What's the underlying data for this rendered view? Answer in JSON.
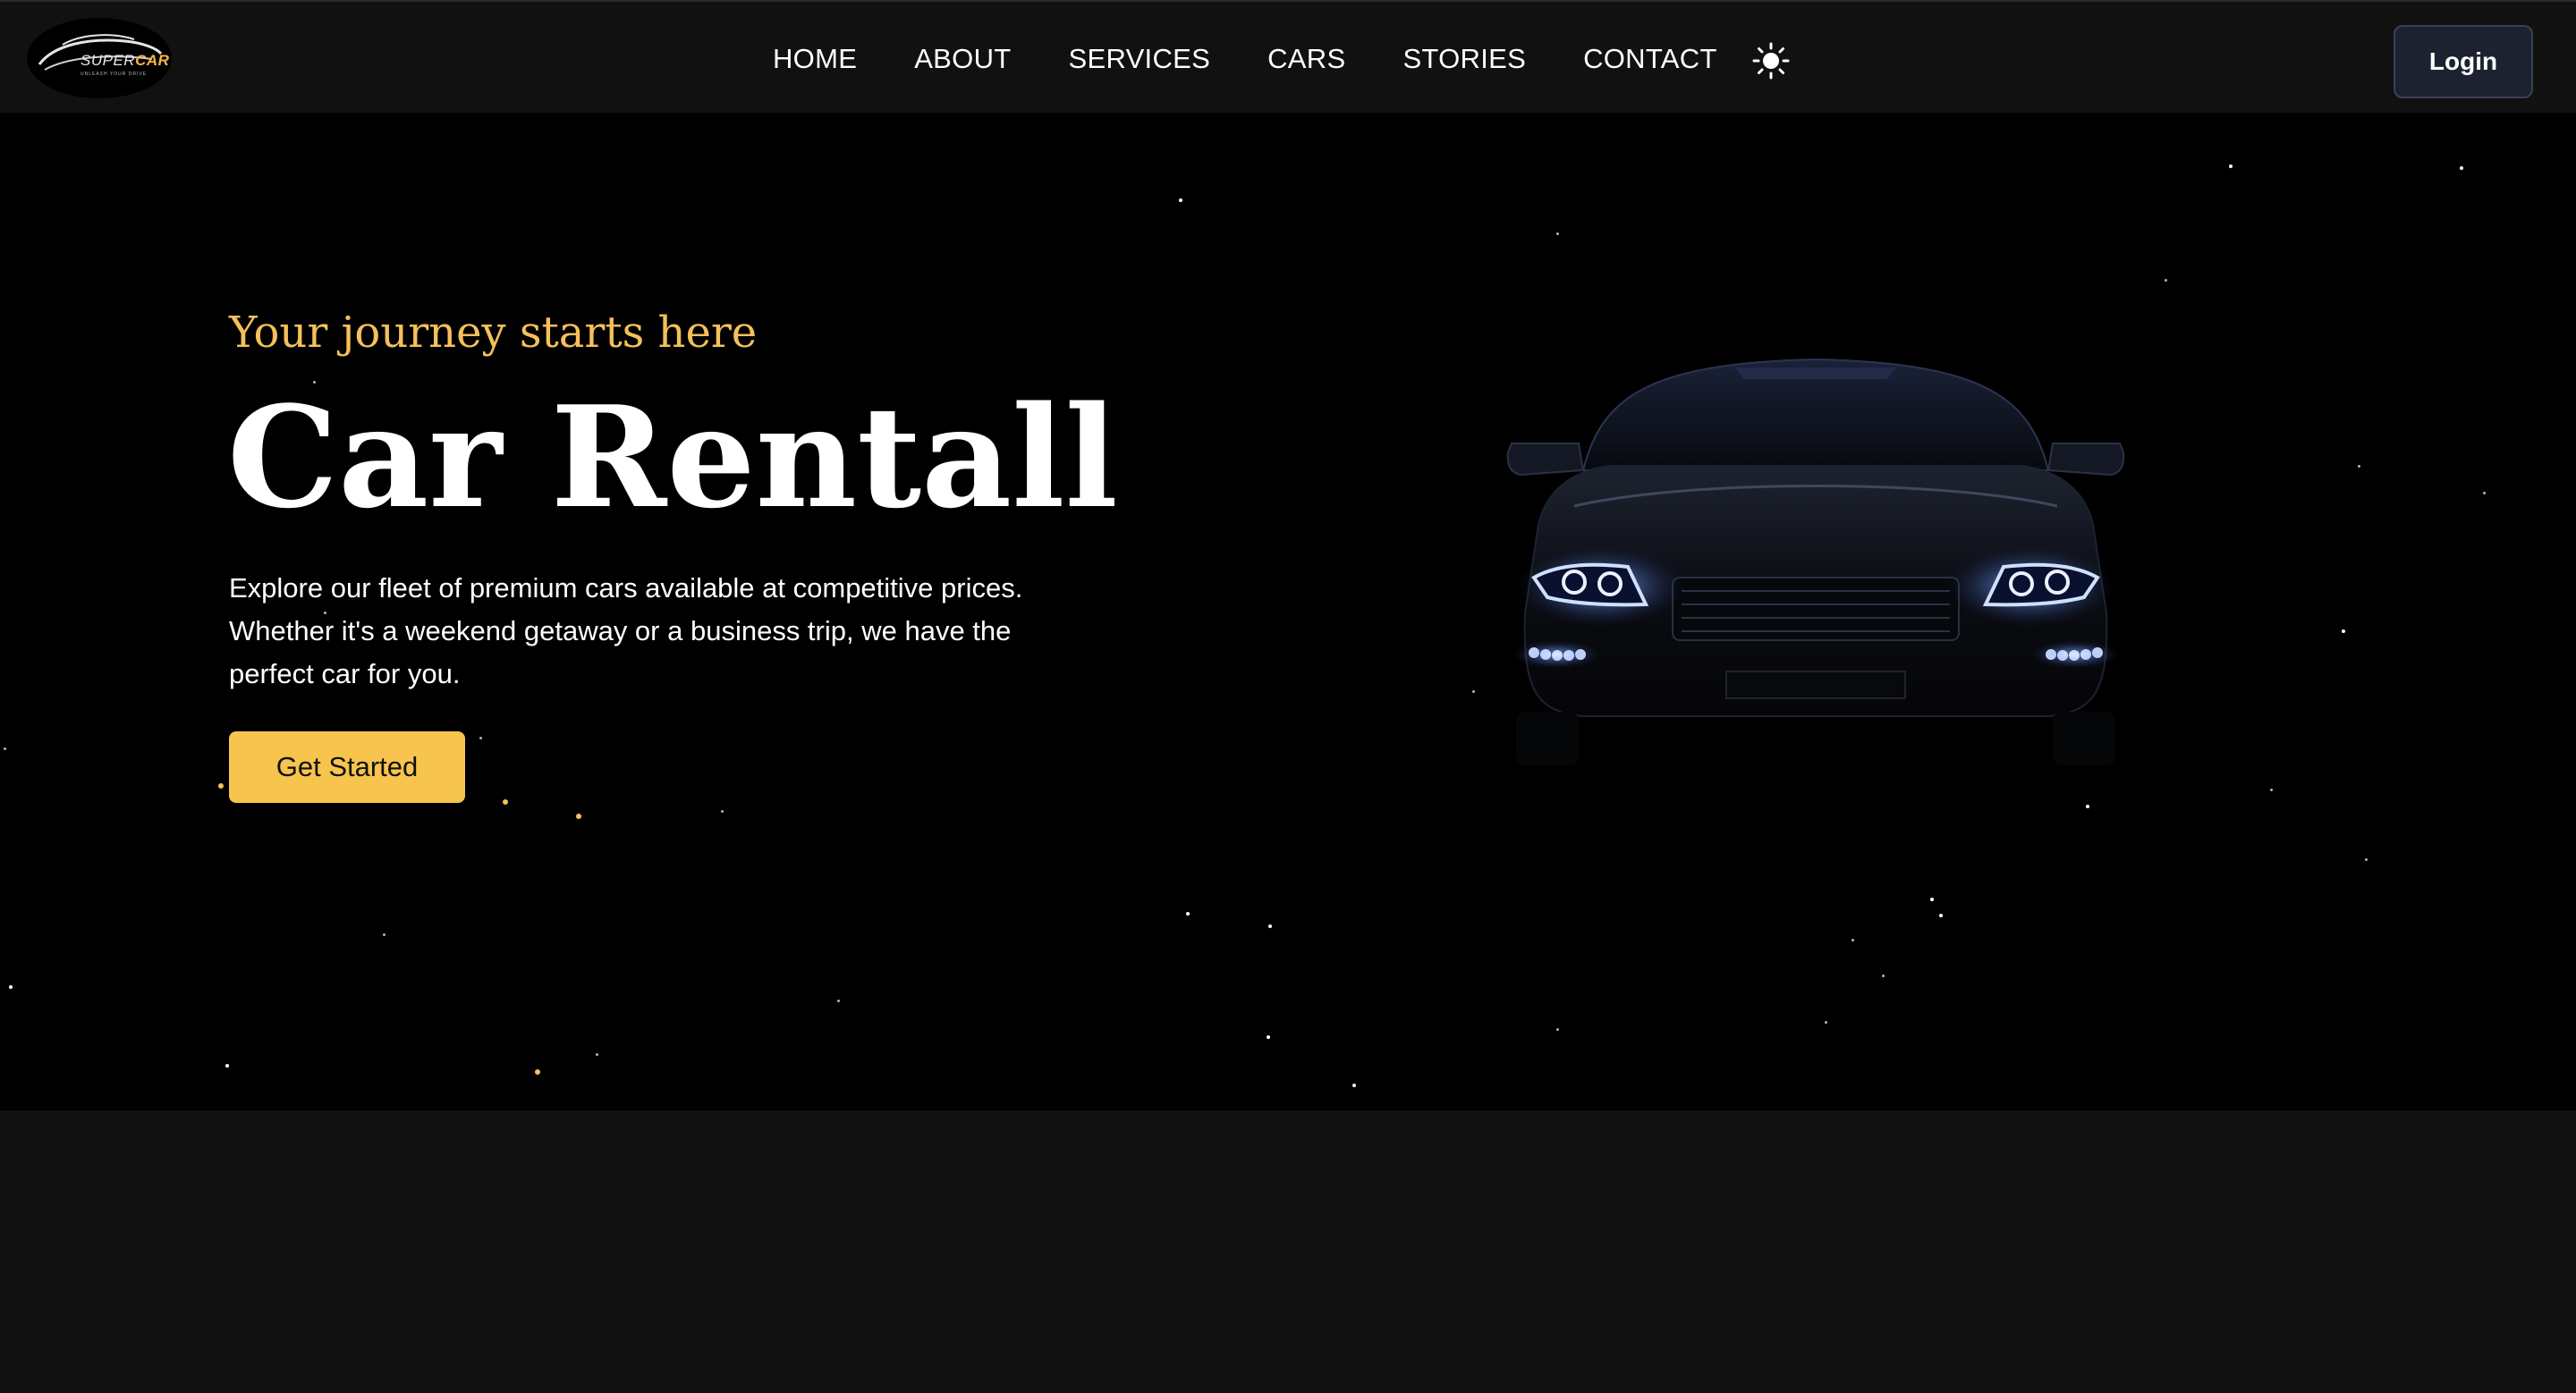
{
  "header": {
    "logo": {
      "brand_white": "SUPER",
      "brand_yellow": "CAR",
      "tagline": "UNLEASH YOUR DRIVE"
    },
    "nav": [
      {
        "label": "HOME"
      },
      {
        "label": "ABOUT"
      },
      {
        "label": "SERVICES"
      },
      {
        "label": "CARS"
      },
      {
        "label": "STORIES"
      },
      {
        "label": "CONTACT"
      }
    ],
    "theme_icon": "sun-icon",
    "login_label": "Login"
  },
  "hero": {
    "subtitle": "Your journey starts here",
    "title": "Car Rentall",
    "description": "Explore our fleet of premium cars available at competitive prices. Whether it's a weekend getaway or a business trip, we have the perfect car for you.",
    "cta_label": "Get Started",
    "image": "car-front-headlights"
  },
  "colors": {
    "accent": "#f7c44d",
    "subtitle": "#f4c05a",
    "nav_bg": "#111111",
    "hero_bg": "#000000",
    "page_bg": "#121212",
    "login_bg": "#1c2230"
  }
}
